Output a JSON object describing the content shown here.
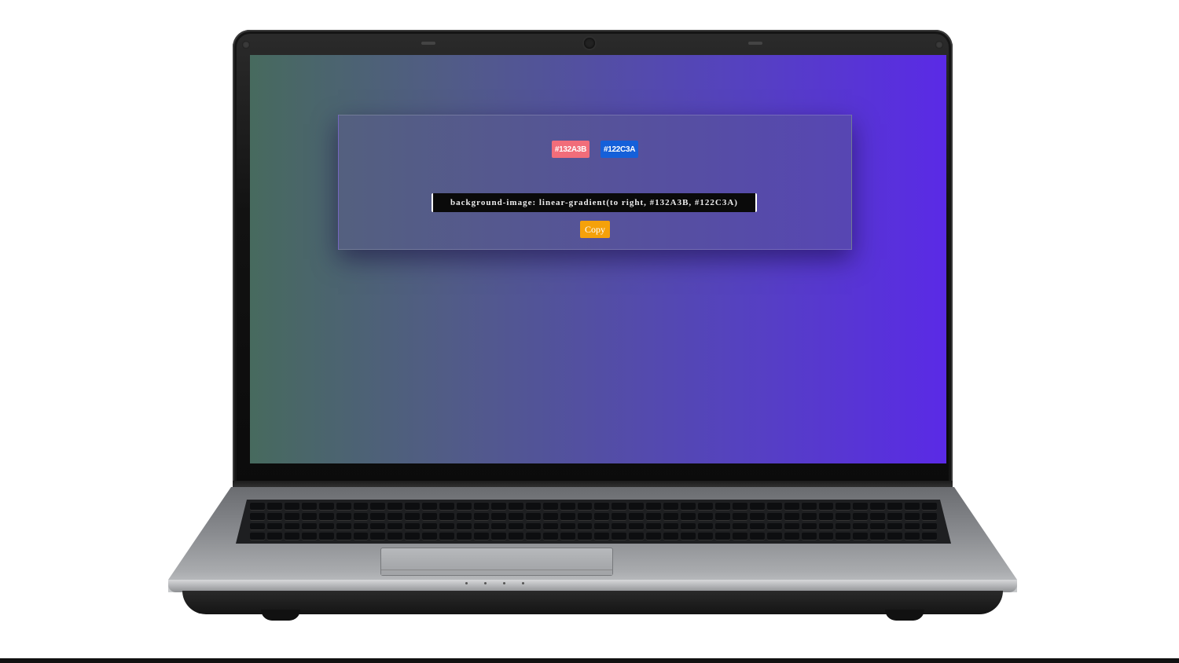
{
  "gradient_app": {
    "color_one": {
      "label": "#132A3B",
      "swatch_color": "#f16d7a"
    },
    "color_two": {
      "label": "#122C3A",
      "swatch_color": "#1560d9"
    },
    "css_output": "background-image: linear-gradient(to right, #132A3B, #122C3A)",
    "copy_label": "Copy",
    "copy_color": "#f5a10a"
  },
  "colors": {
    "screen_gradient_start": "#476a5e",
    "screen_gradient_end": "#5a2ae6"
  }
}
